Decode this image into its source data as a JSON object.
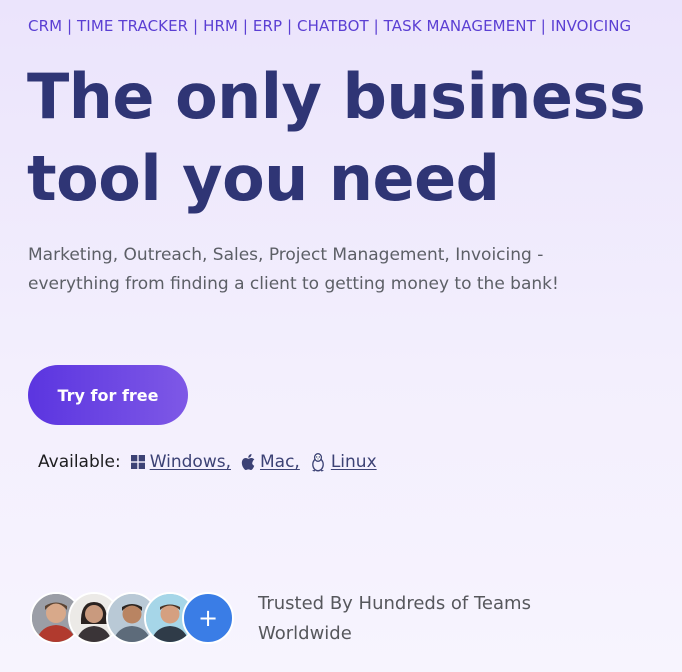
{
  "hero": {
    "top_line": "CRM | TIME TRACKER | HRM | ERP | CHATBOT | TASK MANAGEMENT | INVOICING",
    "headline_line1": "The only business",
    "headline_line2": "tool you need",
    "subtitle": "Marketing, Outreach, Sales, Project Management, Invoicing - everything from finding a client to getting money to the bank!",
    "cta_label": "Try for free"
  },
  "availability": {
    "label": "Available:",
    "platforms": [
      {
        "label": "Windows,",
        "icon": "windows-icon"
      },
      {
        "label": "Mac,",
        "icon": "apple-icon"
      },
      {
        "label": "Linux",
        "icon": "linux-icon"
      }
    ]
  },
  "social_proof": {
    "avatars": [
      {
        "icon": "user-avatar-1"
      },
      {
        "icon": "user-avatar-2"
      },
      {
        "icon": "user-avatar-3"
      },
      {
        "icon": "user-avatar-4"
      }
    ],
    "more_symbol": "+",
    "text": "Trusted By Hundreds of Teams Worldwide"
  },
  "colors": {
    "accent": "#5b35e0",
    "headline": "#2f3575",
    "top_line": "#5b3fd3",
    "plus_avatar": "#3a7de6"
  }
}
